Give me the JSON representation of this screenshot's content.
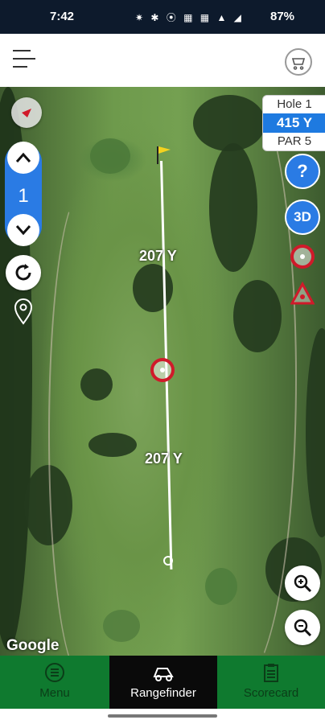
{
  "status": {
    "time": "7:42",
    "icons": "✷ ✱ ⦿ ▦ ▦ ▲ ◢",
    "battery": "87%"
  },
  "topbar": {
    "menu_icon": "hamburger-icon",
    "cart_icon": "golf-cart-icon"
  },
  "hole": {
    "label": "Hole 1",
    "yards": "415 Y",
    "par": "PAR 5",
    "number": "1"
  },
  "map": {
    "distance_top": "207 Y",
    "distance_bottom": "207 Y",
    "attribution": "Google"
  },
  "controls": {
    "help": "?",
    "three_d": "3D"
  },
  "nav": {
    "items": [
      {
        "label": "Menu",
        "icon": "menu-icon"
      },
      {
        "label": "Rangefinder",
        "icon": "rangefinder-icon"
      },
      {
        "label": "Scorecard",
        "icon": "scorecard-icon"
      }
    ],
    "active_color": "#0a0a0a",
    "bar_color": "#0f7a2f"
  }
}
